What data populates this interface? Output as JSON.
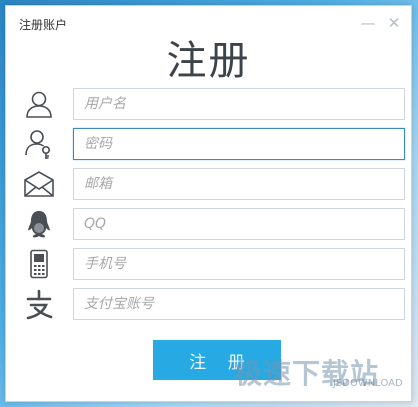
{
  "window": {
    "title": "注册账户",
    "minimize_icon": "minimize-icon",
    "close_icon": "close-icon"
  },
  "heading": "注册",
  "fields": [
    {
      "icon": "user-icon",
      "placeholder": "用户名",
      "value": ""
    },
    {
      "icon": "user-key-icon",
      "placeholder": "密码",
      "value": "",
      "focused": true
    },
    {
      "icon": "envelope-icon",
      "placeholder": "邮箱",
      "value": ""
    },
    {
      "icon": "penguin-icon",
      "placeholder": "QQ",
      "value": ""
    },
    {
      "icon": "phone-icon",
      "placeholder": "手机号",
      "value": ""
    },
    {
      "icon": "alipay-icon",
      "placeholder": "支付宝账号",
      "value": ""
    }
  ],
  "submit_label": "注 册",
  "watermark": {
    "main": "极速下载站",
    "sub": "JSDOWNLOAD"
  },
  "colors": {
    "accent": "#27a9e3",
    "focus_border": "#3b88c8",
    "heading": "#3e4349"
  }
}
